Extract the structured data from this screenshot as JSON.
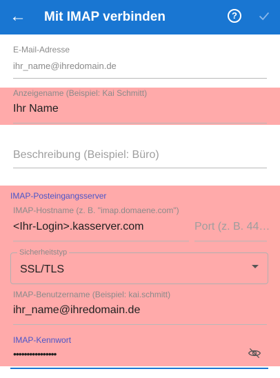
{
  "appbar": {
    "title": "Mit IMAP verbinden",
    "help_label": "?",
    "back_icon": "arrow-left-icon",
    "confirm_icon": "check-icon"
  },
  "email": {
    "label": "E-Mail-Adresse",
    "value": "ihr_name@ihredomain.de"
  },
  "display_name": {
    "label": "Anzeigename (Beispiel: Kai Schmitt)",
    "value": "Ihr Name"
  },
  "description": {
    "placeholder": "Beschreibung (Beispiel: Büro)"
  },
  "incoming": {
    "section_title": "IMAP-Posteingangsserver",
    "hostname_label": "IMAP-Hostname (z. B. \"imap.domaene.com\")",
    "hostname_value": "<Ihr-Login>.kasserver.com",
    "port_placeholder": "Port (z. B. 44…",
    "security_label": "Sicherheitstyp",
    "security_value": "SSL/TLS",
    "username_label": "IMAP-Benutzername (Beispiel: kai.schmitt)",
    "username_value": "ihr_name@ihredomain.de",
    "password_label": "IMAP-Kennwort",
    "password_value": "••••••••••••••••"
  },
  "colors": {
    "appbar": "#1976d2",
    "highlight": "#ffaaaa",
    "section_accent": "#4a55c8"
  }
}
